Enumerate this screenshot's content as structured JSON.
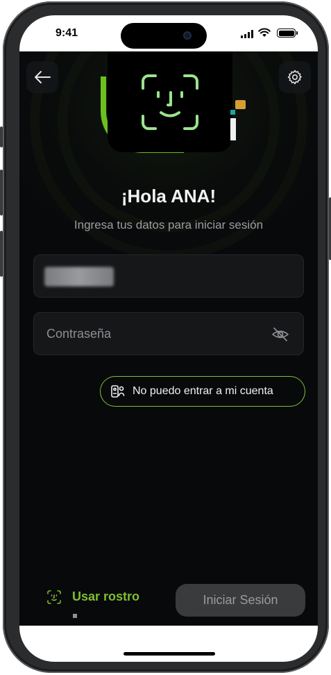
{
  "status_bar": {
    "time": "9:41"
  },
  "header": {
    "back_icon": "arrow-left-icon",
    "settings_icon": "gear-icon"
  },
  "brand": {
    "overlay_icon": "face-id-icon",
    "colors": {
      "green": "#6bbf1e",
      "gold": "#d4a032",
      "teal": "#1ba6a6"
    }
  },
  "greeting": "¡Hola ANA!",
  "subtitle": "Ingresa tus datos para iniciar sesión",
  "form": {
    "user_value_hidden": true,
    "password_placeholder": "Contraseña",
    "password_visibility_icon": "eye-off-icon"
  },
  "help": {
    "cant_enter_label": "No puedo entrar a mi cuenta",
    "icon": "id-card-icon"
  },
  "footer": {
    "face_label": "Usar rostro",
    "face_icon": "face-id-icon",
    "login_label": "Iniciar Sesión"
  },
  "colors": {
    "accent": "#7cc23a",
    "background": "#08090b",
    "button_disabled": "#3a3b3d"
  }
}
